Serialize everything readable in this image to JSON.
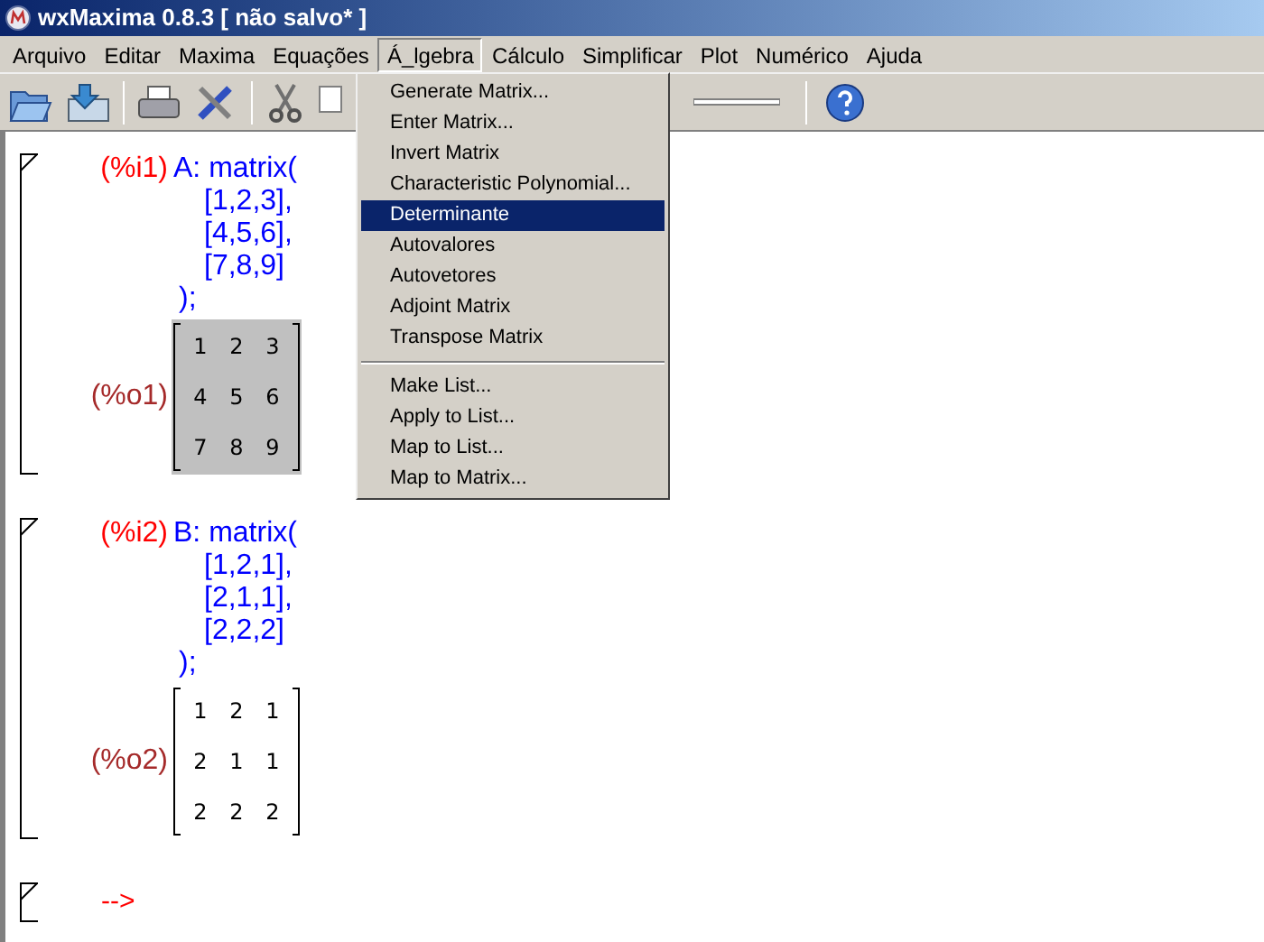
{
  "window": {
    "title": "wxMaxima 0.8.3 [ não salvo* ]"
  },
  "menu": [
    {
      "label": "Arquivo",
      "selected": false
    },
    {
      "label": "Editar",
      "selected": false
    },
    {
      "label": "Maxima",
      "selected": false
    },
    {
      "label": "Equações",
      "selected": false
    },
    {
      "label": "Á_lgebra",
      "selected": true
    },
    {
      "label": "Cálculo",
      "selected": false
    },
    {
      "label": "Simplificar",
      "selected": false
    },
    {
      "label": "Plot",
      "selected": false
    },
    {
      "label": "Numérico",
      "selected": false
    },
    {
      "label": "Ajuda",
      "selected": false
    }
  ],
  "dropdown": [
    {
      "kind": "item",
      "label": "Generate Matrix...",
      "selected": false
    },
    {
      "kind": "item",
      "label": "Enter Matrix...",
      "selected": false
    },
    {
      "kind": "item",
      "label": "Invert Matrix",
      "selected": false
    },
    {
      "kind": "item",
      "label": "Characteristic Polynomial...",
      "selected": false
    },
    {
      "kind": "item",
      "label": "Determinante",
      "selected": true
    },
    {
      "kind": "item",
      "label": "Autovalores",
      "selected": false
    },
    {
      "kind": "item",
      "label": "Autovetores",
      "selected": false
    },
    {
      "kind": "item",
      "label": "Adjoint Matrix",
      "selected": false
    },
    {
      "kind": "item",
      "label": "Transpose Matrix",
      "selected": false
    },
    {
      "kind": "separator"
    },
    {
      "kind": "item",
      "label": "Make List...",
      "selected": false
    },
    {
      "kind": "item",
      "label": "Apply to List...",
      "selected": false
    },
    {
      "kind": "item",
      "label": "Map to List...",
      "selected": false
    },
    {
      "kind": "item",
      "label": "Map to Matrix...",
      "selected": false
    }
  ],
  "cells": [
    {
      "input_label": "(%i1)",
      "input_lines": [
        "A: matrix(",
        "[1,2,3],",
        "[4,5,6],",
        "[7,8,9]",
        ");"
      ],
      "output_label": "(%o1)",
      "output_selected": true,
      "matrix": [
        [
          "1",
          "2",
          "3"
        ],
        [
          "4",
          "5",
          "6"
        ],
        [
          "7",
          "8",
          "9"
        ]
      ]
    },
    {
      "input_label": "(%i2)",
      "input_lines": [
        "B: matrix(",
        "[1,2,1],",
        "[2,1,1],",
        "[2,2,2]",
        ");"
      ],
      "output_label": "(%o2)",
      "output_selected": false,
      "matrix": [
        [
          "1",
          "2",
          "1"
        ],
        [
          "2",
          "1",
          "1"
        ],
        [
          "2",
          "2",
          "2"
        ]
      ]
    }
  ],
  "prompt": "-->"
}
